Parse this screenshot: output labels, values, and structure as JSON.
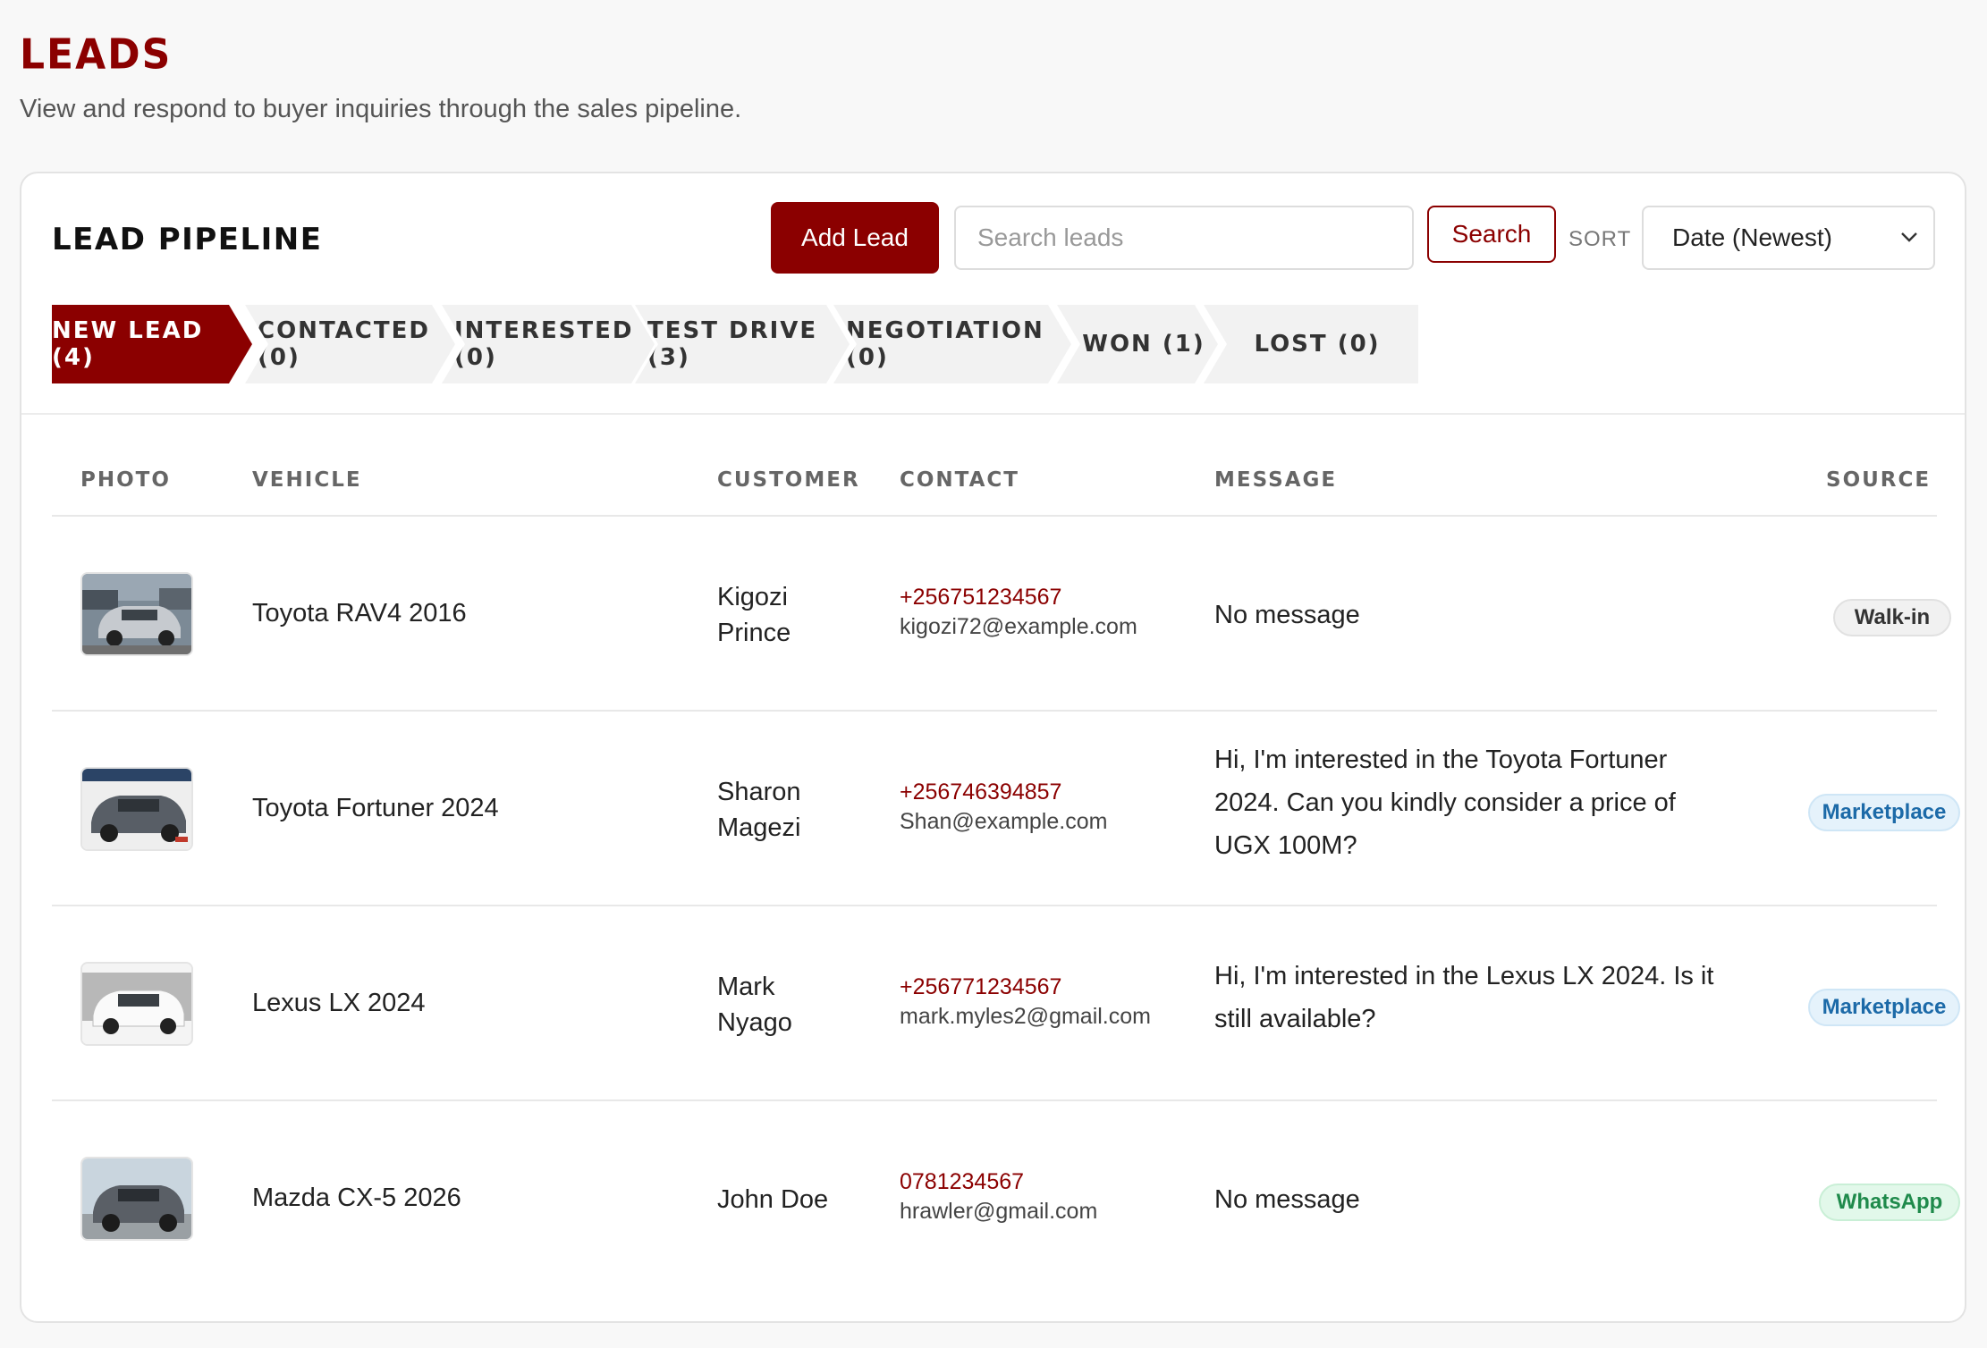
{
  "page": {
    "title": "LEADS",
    "subtitle": "View and respond to buyer inquiries through the sales pipeline."
  },
  "pipeline": {
    "title": "LEAD PIPELINE",
    "add_button": "Add Lead",
    "search_placeholder": "Search leads",
    "search_button": "Search",
    "sort_label": "SORT",
    "sort_value": "Date (Newest)"
  },
  "stages": [
    {
      "label": "NEW LEAD (4)",
      "active": true
    },
    {
      "label": "CONTACTED (0)",
      "active": false
    },
    {
      "label": "INTERESTED (0)",
      "active": false
    },
    {
      "label": "TEST DRIVE (3)",
      "active": false
    },
    {
      "label": "NEGOTIATION (0)",
      "active": false
    },
    {
      "label": "WON (1)",
      "active": false
    },
    {
      "label": "LOST (0)",
      "active": false
    }
  ],
  "table": {
    "headers": {
      "photo": "PHOTO",
      "vehicle": "VEHICLE",
      "customer": "CUSTOMER",
      "contact": "CONTACT",
      "message": "MESSAGE",
      "source": "SOURCE"
    },
    "rows": [
      {
        "vehicle": "Toyota RAV4 2016",
        "customer_first": "Kigozi",
        "customer_last": "Prince",
        "phone": "+256751234567",
        "email": "kigozi72@example.com",
        "message": "No message",
        "source": "Walk-in",
        "photo_icon": "silver-suv-photo"
      },
      {
        "vehicle": "Toyota Fortuner 2024",
        "customer_first": "Sharon",
        "customer_last": "Magezi",
        "phone": "+256746394857",
        "email": "Shan@example.com",
        "message": "Hi, I'm interested in the Toyota Fortuner 2024. Can you kindly consider a price of UGX 100M?",
        "source": "Marketplace",
        "photo_icon": "grey-suv-photo"
      },
      {
        "vehicle": "Lexus LX 2024",
        "customer_first": "Mark",
        "customer_last": "Nyago",
        "phone": "+256771234567",
        "email": "mark.myles2@gmail.com",
        "message": "Hi, I'm interested in the Lexus LX 2024. Is it still available?",
        "source": "Marketplace",
        "photo_icon": "white-suv-photo"
      },
      {
        "vehicle": "Mazda CX-5 2026",
        "customer_first": "John Doe",
        "customer_last": "",
        "phone": "0781234567",
        "email": "hrawler@gmail.com",
        "message": "No message",
        "source": "WhatsApp",
        "photo_icon": "dark-suv-photo"
      }
    ]
  },
  "colors": {
    "brand": "#8b0000",
    "marketplace": "#1c6aa8",
    "whatsapp": "#1f8a4b"
  }
}
